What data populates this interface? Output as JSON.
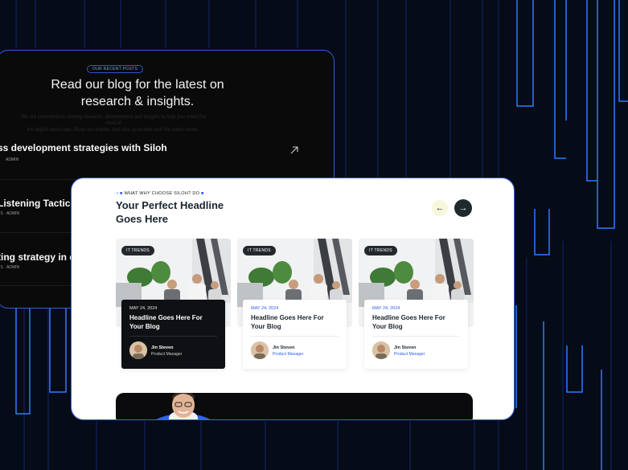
{
  "colors": {
    "background": "#060b18",
    "accent_blue": "#2e5cf0",
    "panel_dark": "#0a0a0b",
    "card_white": "#ffffff"
  },
  "dark_panel": {
    "eyebrow": "OUR RECENT POSTS",
    "heading_line1": "Read our blog for the latest on",
    "heading_line2": "research & insights.",
    "subtext_line1": "We are committed to sharing research, development and insights to help you make the most of",
    "subtext_line2": "the digital landscape. Read our articles and stay up to date with the latest trends.",
    "posts": [
      {
        "title": "ss development strategies with Siloh",
        "category": "",
        "author": "ADMIN"
      },
      {
        "title": "Listening Tactics",
        "category": "SS",
        "author": "ADMIN"
      },
      {
        "title": "ting strategy in d",
        "category": "SS",
        "author": "ADMIN"
      }
    ],
    "arrow_icon": "arrow-up-right-icon"
  },
  "front_card": {
    "kicker": "WHAT WHY CHOOSE SILOH? DO",
    "headline_line1": "Your Perfect Headline",
    "headline_line2": "Goes Here",
    "prev_icon": "arrow-left-icon",
    "next_icon": "arrow-right-icon",
    "prev_glyph": "←",
    "next_glyph": "→",
    "cards": [
      {
        "tag": "IT TRENDS",
        "date": "MAY 24, 2024",
        "title": "Headline Goes Here For Your Blog",
        "author_name": "Jin Steven",
        "author_role": "Product Manager",
        "variant": "dark"
      },
      {
        "tag": "IT TRENDS",
        "date": "MAY 24, 2024",
        "title": "Headline Goes Here For Your Blog",
        "author_name": "Jin Steven",
        "author_role": "Product Manager",
        "variant": "light"
      },
      {
        "tag": "IT TRENDS",
        "date": "MAY 24, 2024",
        "title": "Headline Goes Here For Your Blog",
        "author_name": "Jin Steven",
        "author_role": "Product Manager",
        "variant": "light"
      }
    ]
  }
}
